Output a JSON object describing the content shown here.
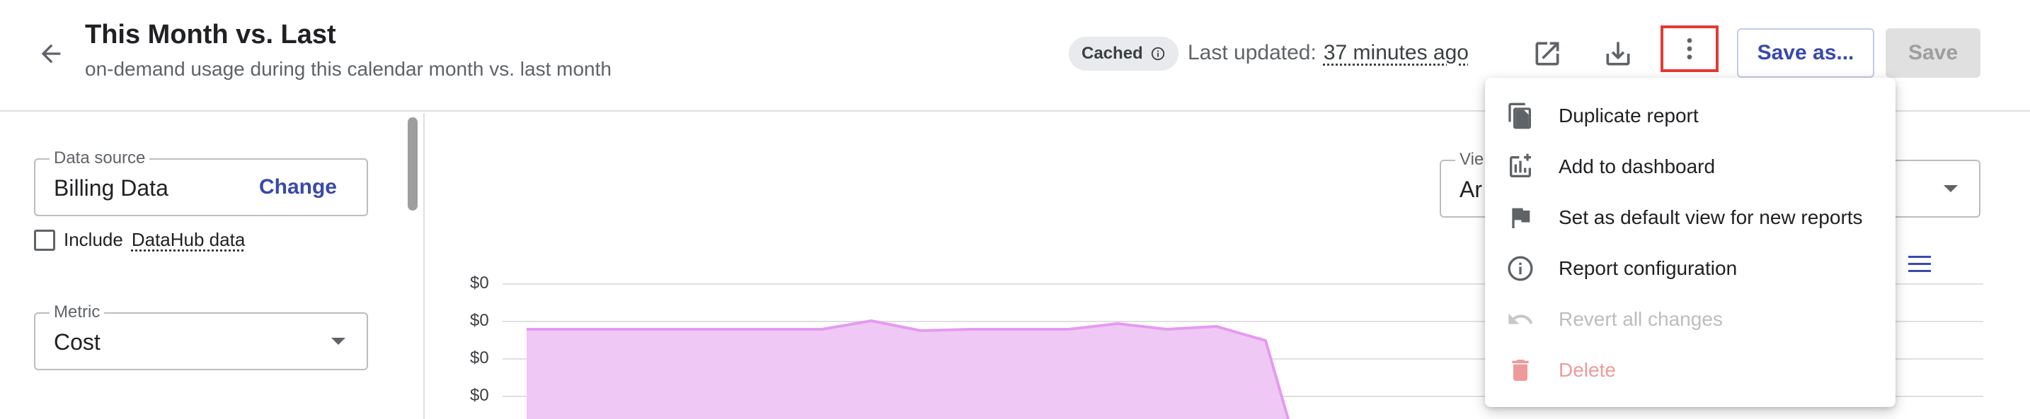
{
  "header": {
    "title": "This Month vs. Last",
    "subtitle": "on-demand usage during this calendar month vs. last month",
    "cached_label": "Cached",
    "last_updated_label": "Last updated:",
    "last_updated_value": "37 minutes ago",
    "save_as_label": "Save as...",
    "save_label": "Save"
  },
  "left_panel": {
    "data_source_label": "Data source",
    "data_source_value": "Billing Data",
    "change_label": "Change",
    "include_prefix": "Include",
    "include_datahub": "DataHub data",
    "include_checked": false,
    "metric_label": "Metric",
    "metric_value": "Cost"
  },
  "view": {
    "label": "Vie",
    "value": "Ar"
  },
  "menu": {
    "items": [
      {
        "label": "Duplicate report",
        "icon": "duplicate-icon",
        "state": "enabled"
      },
      {
        "label": "Add to dashboard",
        "icon": "add-chart-icon",
        "state": "enabled"
      },
      {
        "label": "Set as default view for new reports",
        "icon": "flag-icon",
        "state": "enabled"
      },
      {
        "label": "Report configuration",
        "icon": "info-icon",
        "state": "enabled"
      },
      {
        "label": "Revert all changes",
        "icon": "undo-icon",
        "state": "disabled"
      },
      {
        "label": "Delete",
        "icon": "delete-icon",
        "state": "danger"
      }
    ]
  },
  "colors": {
    "accent": "#3949ab",
    "highlight_border": "#e53935",
    "area_fill": "#f0c8f5",
    "area_stroke": "#e49bf0"
  },
  "chart_data": {
    "type": "area",
    "y_tick_labels": [
      "$0",
      "$0",
      "$0",
      "$0"
    ],
    "grid": true,
    "series": [
      {
        "values": [
          100,
          100,
          100,
          100,
          100,
          100,
          100,
          106,
          99,
          100,
          100,
          100,
          104,
          100,
          102,
          92
        ]
      }
    ]
  }
}
